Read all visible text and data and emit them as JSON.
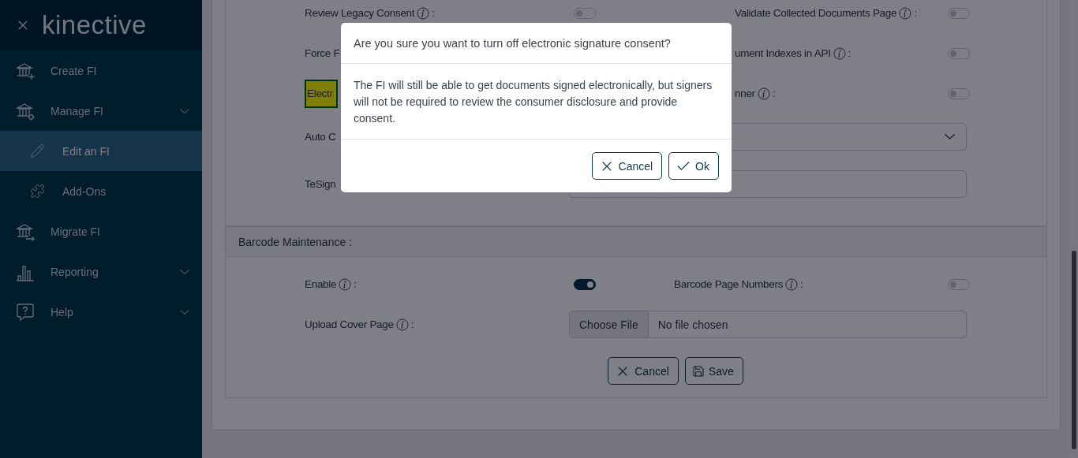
{
  "sidebar": {
    "logo": "kinective",
    "items": [
      {
        "label": "Create FI",
        "selected": false
      },
      {
        "label": "Manage FI",
        "has_submenu": true,
        "selected": false,
        "children": [
          {
            "label": "Edit an FI",
            "selected": true
          },
          {
            "label": "Add-Ons",
            "selected": false
          }
        ]
      },
      {
        "label": "Migrate FI",
        "selected": false
      },
      {
        "label": "Reporting",
        "has_submenu": true,
        "selected": false
      },
      {
        "label": "Help",
        "has_submenu": true,
        "selected": false
      }
    ]
  },
  "sections": [
    {
      "rows": [
        {
          "kind": "toggles",
          "left": {
            "label": "Review Legacy Consent",
            "info": true,
            "suffix": ":",
            "on": false
          },
          "right": {
            "label": "Validate Collected Documents Page",
            "info": true,
            "suffix": ":",
            "on": false
          }
        },
        {
          "kind": "toggles",
          "left": {
            "label": "Force F"
          },
          "right": {
            "label": "ument Indexes in API",
            "info": true,
            "suffix": ":",
            "on": false
          }
        },
        {
          "kind": "toggles",
          "left": {
            "label": "Electr",
            "highlighted": true
          },
          "right": {
            "label": "nner",
            "info": true,
            "suffix": ":",
            "on": false
          }
        },
        {
          "kind": "select",
          "left": {
            "label": "Auto C"
          }
        },
        {
          "kind": "text",
          "left": {
            "label": "TeSign"
          }
        }
      ]
    },
    {
      "title": "Barcode Maintenance :",
      "rows": [
        {
          "kind": "toggles",
          "left": {
            "label": "Enable",
            "info": true,
            "suffix": ":",
            "on": true
          },
          "right": {
            "label": "Barcode Page Numbers",
            "info": true,
            "suffix": ":",
            "on": false
          }
        },
        {
          "kind": "file",
          "left": {
            "label": "Upload Cover Page",
            "info": true,
            "suffix": ":"
          },
          "button": "Choose File",
          "status": "No file chosen"
        }
      ],
      "buttons": [
        {
          "label": "Cancel",
          "kind": "cancel"
        },
        {
          "label": "Save",
          "kind": "save"
        }
      ]
    }
  ],
  "modal": {
    "title": "Are you sure you want to turn off electronic signature consent?",
    "message": "The FI will still be able to get documents signed electronically, but signers will not be required to review the consumer disclosure and provide consent.",
    "buttons": [
      {
        "label": "Cancel",
        "kind": "cancel"
      },
      {
        "label": "Ok",
        "kind": "ok"
      }
    ]
  }
}
